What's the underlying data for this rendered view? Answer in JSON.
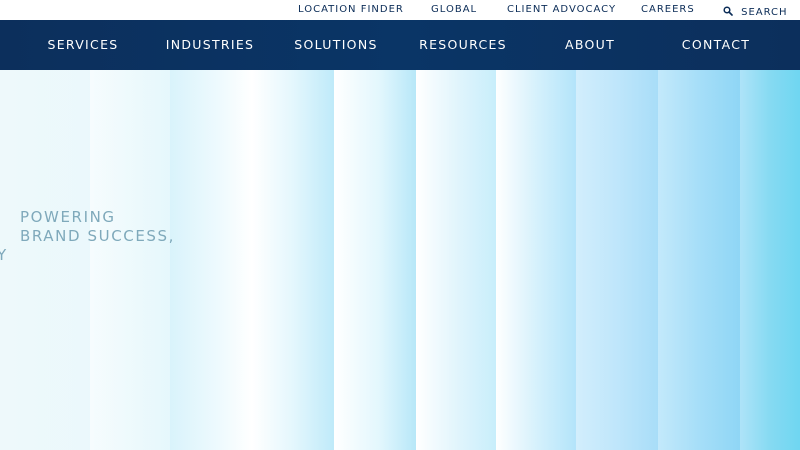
{
  "utility_nav": {
    "location_finder": "LOCATION FINDER",
    "global": "GLOBAL",
    "client_advocacy": "CLIENT ADVOCACY",
    "careers": "CAREERS",
    "search": "SEARCH",
    "search_icon": "search-icon"
  },
  "main_nav": {
    "services": "SERVICES",
    "industries": "INDUSTRIES",
    "solutions": "SOLUTIONS",
    "resources": "RESOURCES",
    "about": "ABOUT",
    "contact": "CONTACT"
  },
  "hero": {
    "line1": "POWERING",
    "line2": "BRAND SUCCESS,",
    "fragment": "Y"
  },
  "colors": {
    "nav_background": "#0c2f5c",
    "nav_text": "#ffffff",
    "utility_text": "#0b2c57",
    "hero_text": "#7fa9bb",
    "hero_light": "#eef9fb",
    "hero_accent": "#8fdcf4"
  }
}
